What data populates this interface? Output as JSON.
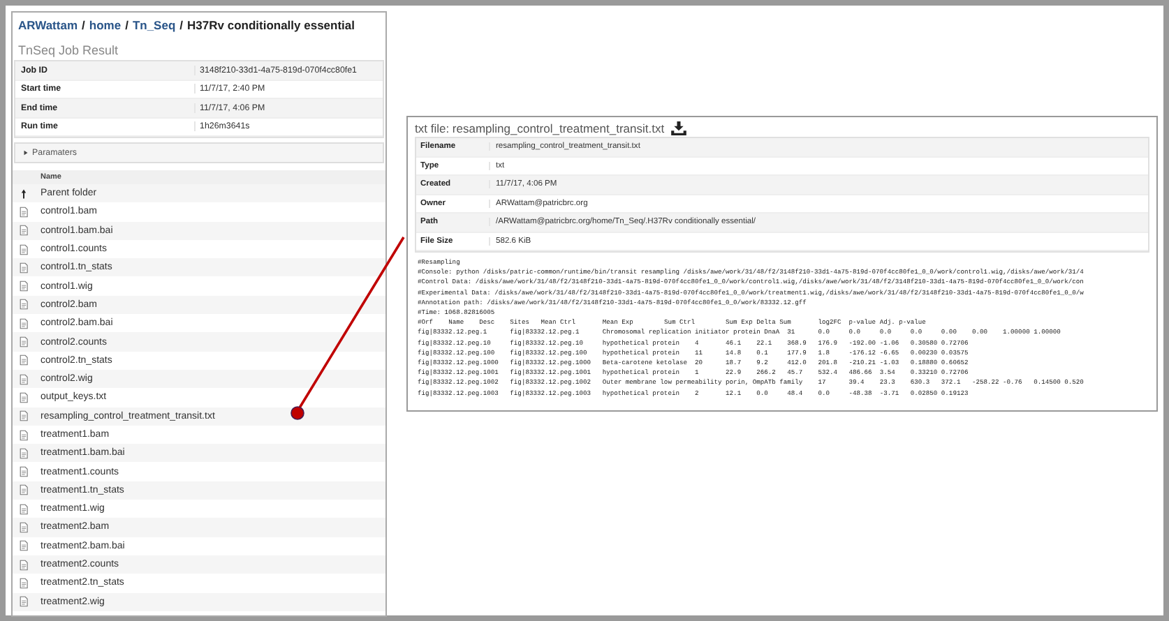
{
  "breadcrumb": {
    "links": [
      "ARWattam",
      "home",
      "Tn_Seq"
    ],
    "separator": "/",
    "current": "H37Rv conditionally essential"
  },
  "job_result": {
    "title": "TnSeq Job Result",
    "rows": [
      {
        "label": "Job ID",
        "value": "3148f210-33d1-4a75-819d-070f4cc80fe1"
      },
      {
        "label": "Start time",
        "value": "11/7/17, 2:40 PM"
      },
      {
        "label": "End time",
        "value": "11/7/17, 4:06 PM"
      },
      {
        "label": "Run time",
        "value": "1h26m3641s"
      }
    ],
    "parameters": {
      "label": "Paramaters",
      "expanded": false
    }
  },
  "file_list": {
    "column": "Name",
    "items": [
      {
        "name": "Parent folder",
        "kind": "parent"
      },
      {
        "name": "control1.bam",
        "kind": "file"
      },
      {
        "name": "control1.bam.bai",
        "kind": "file"
      },
      {
        "name": "control1.counts",
        "kind": "file"
      },
      {
        "name": "control1.tn_stats",
        "kind": "file"
      },
      {
        "name": "control1.wig",
        "kind": "file"
      },
      {
        "name": "control2.bam",
        "kind": "file"
      },
      {
        "name": "control2.bam.bai",
        "kind": "file"
      },
      {
        "name": "control2.counts",
        "kind": "file"
      },
      {
        "name": "control2.tn_stats",
        "kind": "file"
      },
      {
        "name": "control2.wig",
        "kind": "file"
      },
      {
        "name": "output_keys.txt",
        "kind": "file"
      },
      {
        "name": "resampling_control_treatment_transit.txt",
        "kind": "file"
      },
      {
        "name": "treatment1.bam",
        "kind": "file"
      },
      {
        "name": "treatment1.bam.bai",
        "kind": "file"
      },
      {
        "name": "treatment1.counts",
        "kind": "file"
      },
      {
        "name": "treatment1.tn_stats",
        "kind": "file"
      },
      {
        "name": "treatment1.wig",
        "kind": "file"
      },
      {
        "name": "treatment2.bam",
        "kind": "file"
      },
      {
        "name": "treatment2.bam.bai",
        "kind": "file"
      },
      {
        "name": "treatment2.counts",
        "kind": "file"
      },
      {
        "name": "treatment2.tn_stats",
        "kind": "file"
      },
      {
        "name": "treatment2.wig",
        "kind": "file"
      }
    ]
  },
  "file_preview": {
    "title": "txt file: resampling_control_treatment_transit.txt",
    "rows": [
      {
        "label": "Filename",
        "value": "resampling_control_treatment_transit.txt"
      },
      {
        "label": "Type",
        "value": "txt"
      },
      {
        "label": "Created",
        "value": "11/7/17, 4:06 PM"
      },
      {
        "label": "Owner",
        "value": "ARWattam@patricbrc.org"
      },
      {
        "label": "Path",
        "value": "/ARWattam@patricbrc.org/home/Tn_Seq/.H37Rv conditionally essential/"
      },
      {
        "label": "File Size",
        "value": "582.6 KiB"
      }
    ],
    "content_lines": [
      "#Resampling",
      "#Console: python /disks/patric-common/runtime/bin/transit resampling /disks/awe/work/31/48/f2/3148f210-33d1-4a75-819d-070f4cc80fe1_0_0/work/control1.wig,/disks/awe/work/31/4",
      "#Control Data: /disks/awe/work/31/48/f2/3148f210-33d1-4a75-819d-070f4cc80fe1_0_0/work/control1.wig,/disks/awe/work/31/48/f2/3148f210-33d1-4a75-819d-070f4cc80fe1_0_0/work/con",
      "#Experimental Data: /disks/awe/work/31/48/f2/3148f210-33d1-4a75-819d-070f4cc80fe1_0_0/work/treatment1.wig,/disks/awe/work/31/48/f2/3148f210-33d1-4a75-819d-070f4cc80fe1_0_0/w",
      "#Annotation path: /disks/awe/work/31/48/f2/3148f210-33d1-4a75-819d-070f4cc80fe1_0_0/work/83332.12.gff",
      "#Time: 1068.82816005",
      "#Orf\tName\tDesc\tSites\tMean Ctrl\tMean Exp\tSum Ctrl\tSum Exp\tDelta Sum\tlog2FC\tp-value\tAdj. p-value",
      "fig|83332.12.peg.1\tfig|83332.12.peg.1\tChromosomal replication initiator protein DnaA\t31\t0.0\t0.0\t0.0\t0.0\t0.00\t0.00\t1.00000\t1.00000",
      "fig|83332.12.peg.10\tfig|83332.12.peg.10\thypothetical protein\t4\t46.1\t22.1\t368.9\t176.9\t-192.00\t-1.06\t0.30580\t0.72706",
      "fig|83332.12.peg.100\tfig|83332.12.peg.100\thypothetical protein\t11\t14.8\t0.1\t177.9\t1.8\t-176.12\t-6.65\t0.00230\t0.03575",
      "fig|83332.12.peg.1000\tfig|83332.12.peg.1000\tBeta-carotene ketolase\t20\t18.7\t9.2\t412.0\t201.8\t-210.21\t-1.03\t0.18880\t0.60652",
      "fig|83332.12.peg.1001\tfig|83332.12.peg.1001\thypothetical protein\t1\t22.9\t266.2\t45.7\t532.4\t486.66\t3.54\t0.33210\t0.72706",
      "fig|83332.12.peg.1002\tfig|83332.12.peg.1002\tOuter membrane low permeability porin, OmpATb family\t17\t39.4\t23.3\t630.3\t372.1\t-258.22\t-0.76\t0.14500\t0.520",
      "fig|83332.12.peg.1003\tfig|83332.12.peg.1003\thypothetical protein\t2\t12.1\t0.0\t48.4\t0.0\t-48.38\t-3.71\t0.02850\t0.19123"
    ]
  }
}
